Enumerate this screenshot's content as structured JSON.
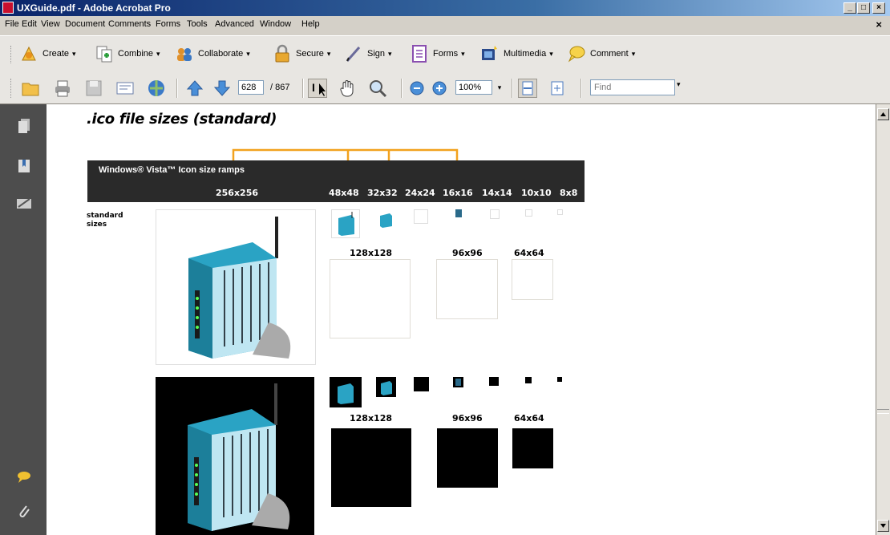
{
  "window": {
    "title": "UXGuide.pdf - Adobe Acrobat Pro",
    "close_menu_glyph": "×",
    "minimize_glyph": "_",
    "restore_glyph": "□",
    "close_glyph": "×"
  },
  "menu": {
    "items": [
      "File",
      "Edit",
      "View",
      "Document",
      "Comments",
      "Forms",
      "Tools",
      "Advanced",
      "Window",
      "Help"
    ]
  },
  "task_toolbar": {
    "items": [
      {
        "label": "Create",
        "icon": "create-icon"
      },
      {
        "label": "Combine",
        "icon": "combine-icon"
      },
      {
        "label": "Collaborate",
        "icon": "collaborate-icon"
      },
      {
        "label": "Secure",
        "icon": "lock-icon"
      },
      {
        "label": "Sign",
        "icon": "pen-icon"
      },
      {
        "label": "Forms",
        "icon": "forms-icon"
      },
      {
        "label": "Multimedia",
        "icon": "multimedia-icon"
      },
      {
        "label": "Comment",
        "icon": "comment-bubble-icon"
      }
    ],
    "dropdown_glyph": "▾"
  },
  "nav_toolbar": {
    "current_page": "628",
    "page_total": "/ 867",
    "zoom": "100%",
    "find_placeholder": "Find",
    "dropdown_glyph": "▾",
    "select_glyph": "I"
  },
  "document": {
    "heading": ".ico file sizes (standard)",
    "ramp_title": "Windows® Vista™ Icon size ramps",
    "ramp_labels": [
      "256x256",
      "48x48",
      "32x32",
      "24x24",
      "16x16",
      "14x14",
      "10x10",
      "8x8"
    ],
    "row_label": "standard sizes",
    "row_label_line1": "standard",
    "row_label_line2": "sizes",
    "extra_sizes_row1": [
      "128x128",
      "96x96",
      "64x64"
    ],
    "extra_sizes_row2": [
      "128x128",
      "96x96",
      "64x64"
    ]
  },
  "colors": {
    "accent_orange": "#f2a21e",
    "ramp_bar": "#2a2a2a",
    "nav_panel": "#4d4d4d",
    "modem_blue": "#2aa3c4"
  }
}
